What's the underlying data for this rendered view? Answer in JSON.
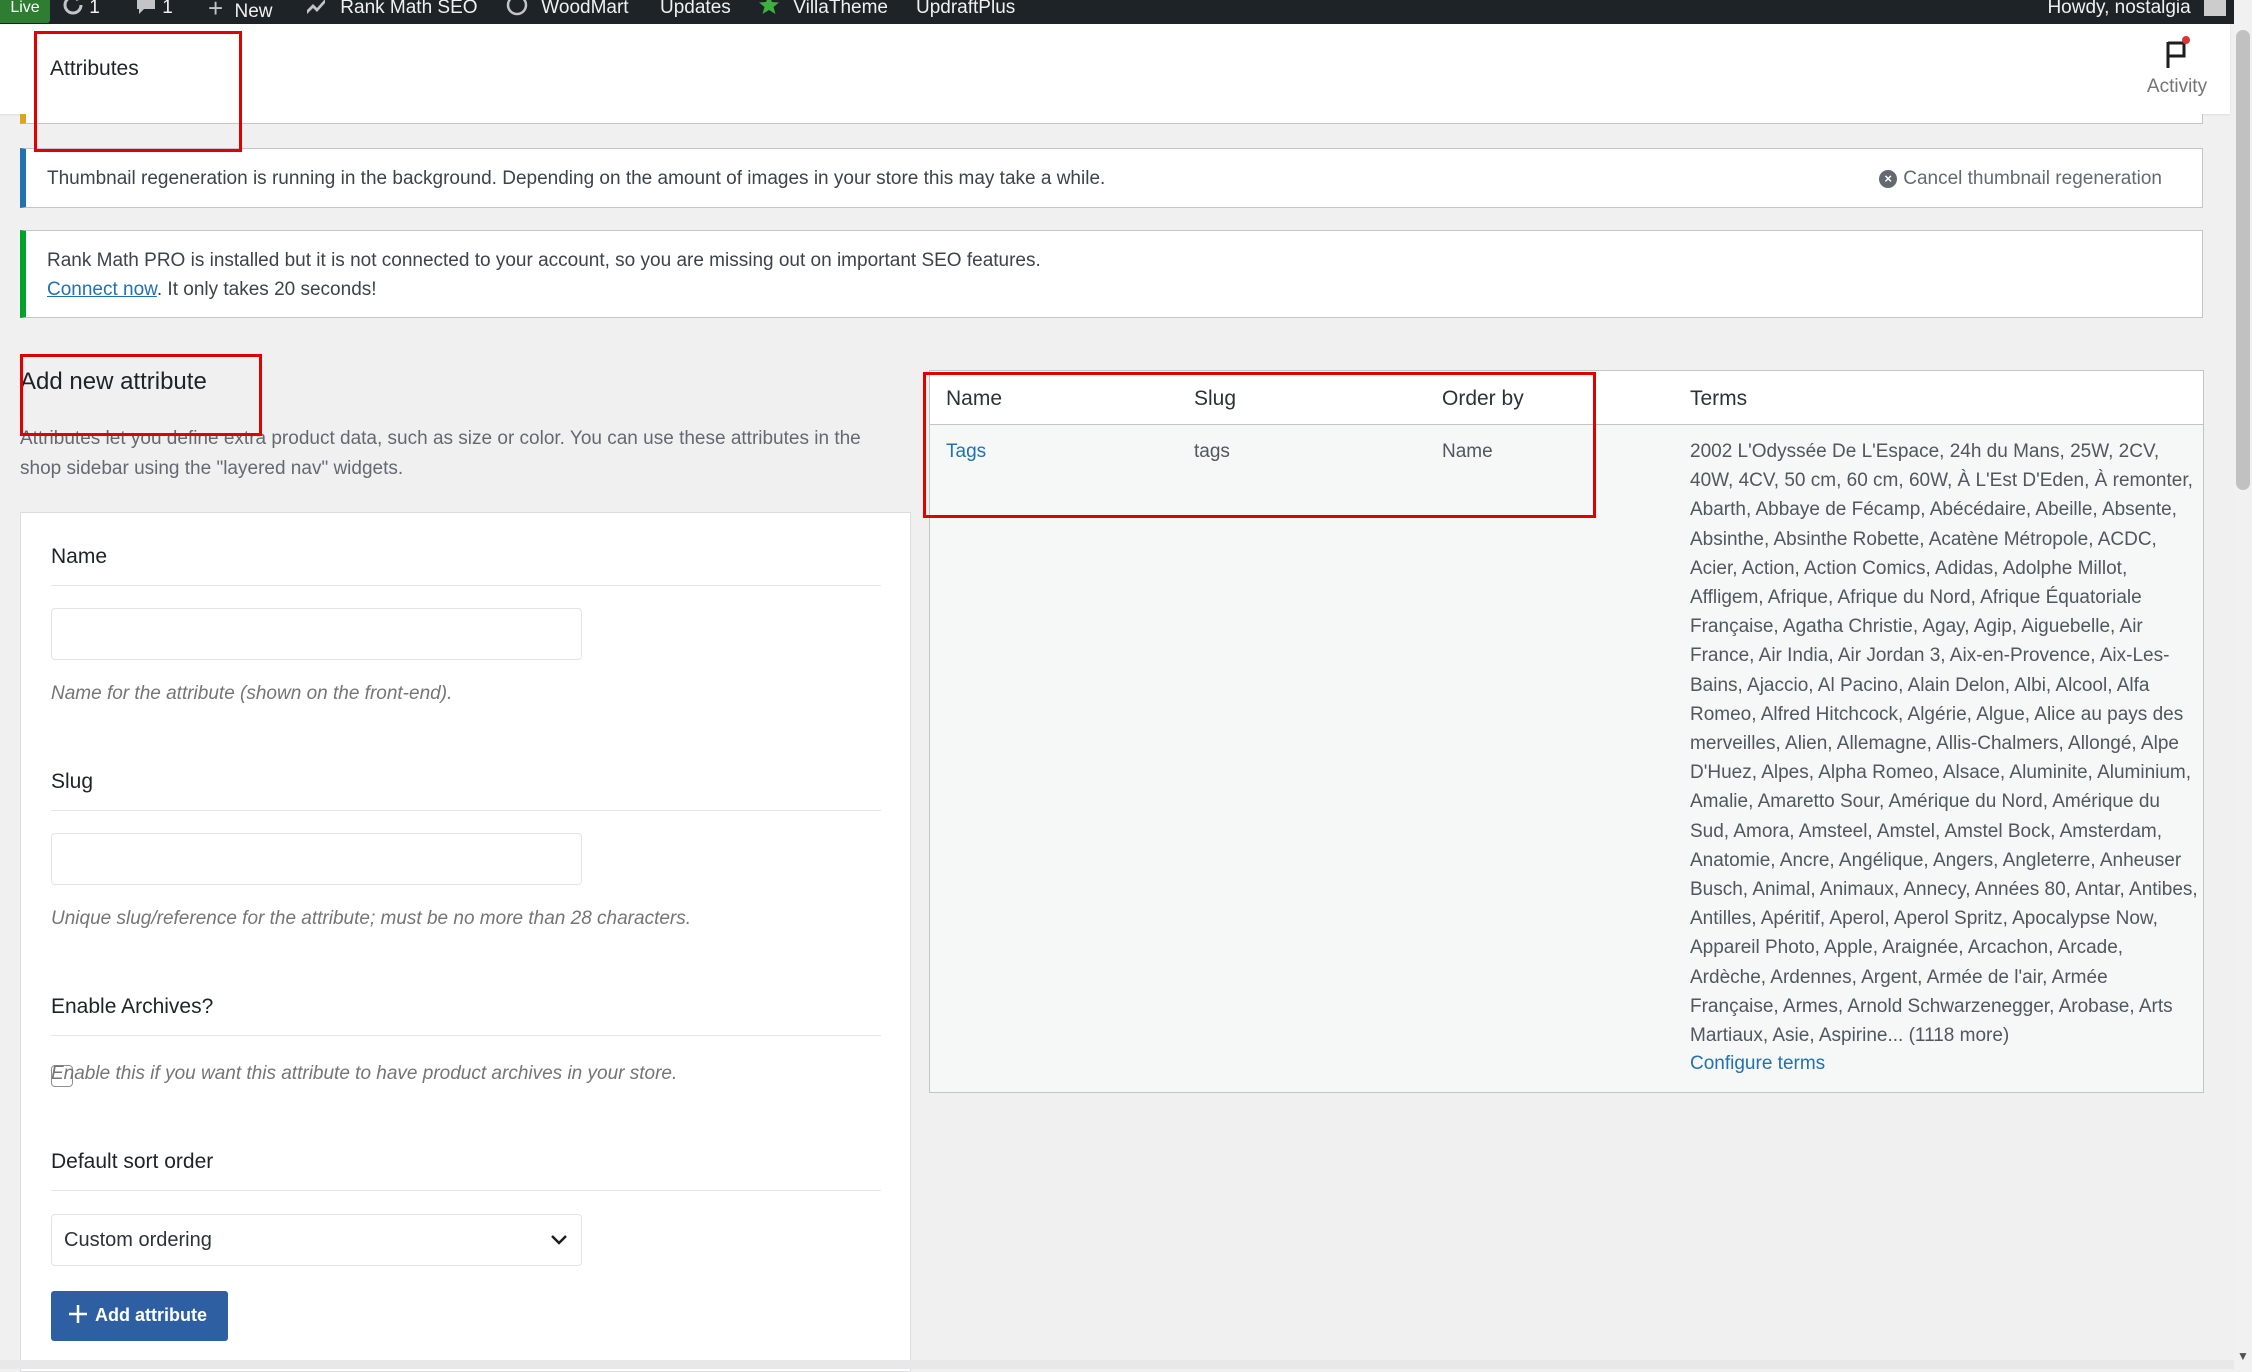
{
  "admin_bar": {
    "live_badge": "Live",
    "updates_count": "1",
    "comments_count": "1",
    "new_label": "New",
    "rank_math": "Rank Math SEO",
    "woodmart": "WoodMart",
    "updates": "Updates",
    "villatheme": "VillaTheme",
    "updraftplus": "UpdraftPlus",
    "howdy": "Howdy, nostalgia"
  },
  "header": {
    "title": "Attributes",
    "activity_label": "Activity"
  },
  "notices": {
    "thumbnail": "Thumbnail regeneration is running in the background. Depending on the amount of images in your store this may take a while.",
    "cancel_label": "Cancel thumbnail regeneration",
    "rank_math_line1": "Rank Math PRO is installed but it is not connected to your account, so you are missing out on important SEO features.",
    "connect_link": "Connect now",
    "rank_math_line2_rest": ". It only takes 20 seconds!"
  },
  "add_form": {
    "title": "Add new attribute",
    "description": "Attributes let you define extra product data, such as size or color. You can use these attributes in the shop sidebar using the \"layered nav\" widgets.",
    "name_label": "Name",
    "name_value": "",
    "name_help": "Name for the attribute (shown on the front-end).",
    "slug_label": "Slug",
    "slug_value": "",
    "slug_help": "Unique slug/reference for the attribute; must be no more than 28 characters.",
    "archives_label": "Enable Archives?",
    "archives_help": "Enable this if you want this attribute to have product archives in your store.",
    "sort_label": "Default sort order",
    "sort_value": "Custom ordering",
    "submit_label": "Add attribute"
  },
  "table": {
    "headers": {
      "name": "Name",
      "slug": "Slug",
      "order_by": "Order by",
      "terms": "Terms"
    },
    "rows": [
      {
        "name": "Tags",
        "slug": "tags",
        "order_by": "Name",
        "terms": "2002 L'Odyssée De L'Espace, 24h du Mans, 25W, 2CV, 40W, 4CV, 50 cm, 60 cm, 60W, À L'Est D'Eden, À remonter, Abarth, Abbaye de Fécamp, Abécédaire, Abeille, Absente, Absinthe, Absinthe Robette, Acatène Métropole, ACDC, Acier, Action, Action Comics, Adidas, Adolphe Millot, Affligem, Afrique, Afrique du Nord, Afrique Équatoriale Française, Agatha Christie, Agay, Agip, Aiguebelle, Air France, Air India, Air Jordan 3, Aix-en-Provence, Aix-Les-Bains, Ajaccio, Al Pacino, Alain Delon, Albi, Alcool, Alfa Romeo, Alfred Hitchcock, Algérie, Algue, Alice au pays des merveilles, Alien, Allemagne, Allis-Chalmers, Allongé, Alpe D'Huez, Alpes, Alpha Romeo, Alsace, Aluminite, Aluminium, Amalie, Amaretto Sour, Amérique du Nord, Amérique du Sud, Amora, Amsteel, Amstel, Amstel Bock, Amsterdam, Anatomie, Ancre, Angélique, Angers, Angleterre, Anheuser Busch, Animal, Animaux, Annecy, Années 80, Antar, Antibes, Antilles, Apéritif, Aperol, Aperol Spritz, Apocalypse Now, Appareil Photo, Apple, Araignée, Arcachon, Arcade, Ardèche, Ardennes, Argent, Armée de l'air, Armée Française, Armes, Arnold Schwarzenegger, Arobase, Arts Martiaux, Asie, Aspirine... (1118 more)",
        "configure_label": "Configure terms"
      }
    ]
  },
  "colors": {
    "admin_bar": "#1d2327",
    "link": "#2271b1",
    "primary_button": "#2e5fa3",
    "highlight": "#e00000",
    "notice_info": "#2271b1",
    "notice_success": "#00a32a"
  }
}
